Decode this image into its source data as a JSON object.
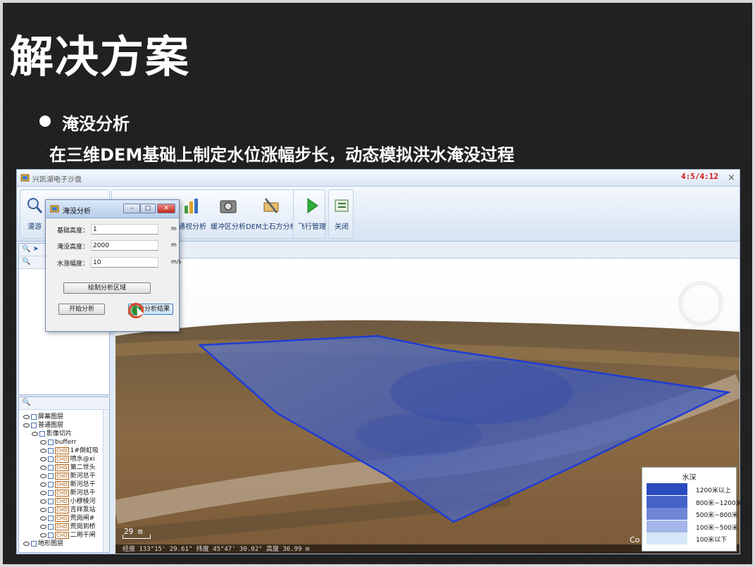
{
  "slide": {
    "title": "解决方案",
    "bullet": "淹没分析",
    "subtitle": "在三维DEM基础上制定水位涨幅步长，动态模拟洪水淹没过程"
  },
  "app": {
    "title": "兴凯湖电子沙盘",
    "fps": "4:5/4:12",
    "close": "×"
  },
  "ribbon": {
    "roam": "漫游",
    "visibility": "通视分析",
    "buffer": "缓冲区分析",
    "earthwork": "DEM土石方分析",
    "flight": "飞行管理",
    "close": "关闭"
  },
  "layers": {
    "items": [
      "屏幕图层",
      "普通图层",
      "影像切片",
      "bufferr",
      "1#倒虹吸",
      "喷水@xi",
      "第二世头",
      "新河总干",
      "新河总干",
      "新河总干",
      "小穆棱河",
      "吉祥泵站",
      "荒岗闸#",
      "荒岗到桥",
      "二用干闸",
      "地形图层"
    ]
  },
  "dialog": {
    "title": "淹没分析",
    "base_label": "基础高度：",
    "base_value": "1",
    "base_unit": "m",
    "flood_label": "淹没高度：",
    "flood_value": "2000",
    "flood_unit": "m",
    "rise_label": "水涨幅度：",
    "rise_value": "10",
    "rise_unit": "m/s",
    "draw_btn": "绘制分析区域",
    "start_btn": "开始分析",
    "result_btn": "查看分析结果"
  },
  "map": {
    "scale": "29 m",
    "status": "经度 133°15' 29.61\"  纬度 45°47' 30.02\"  高度 36.99 m",
    "copyright": "Co"
  },
  "legend": {
    "title": "水深",
    "items": [
      {
        "label": "1200米以上",
        "color": "#2a4bbf"
      },
      {
        "label": "800米~1200米",
        "color": "#4562c8"
      },
      {
        "label": "500米~800米",
        "color": "#6d86d6"
      },
      {
        "label": "100米~500米",
        "color": "#a4b5e8"
      },
      {
        "label": "100米以下",
        "color": "#d6e6f8"
      }
    ]
  }
}
